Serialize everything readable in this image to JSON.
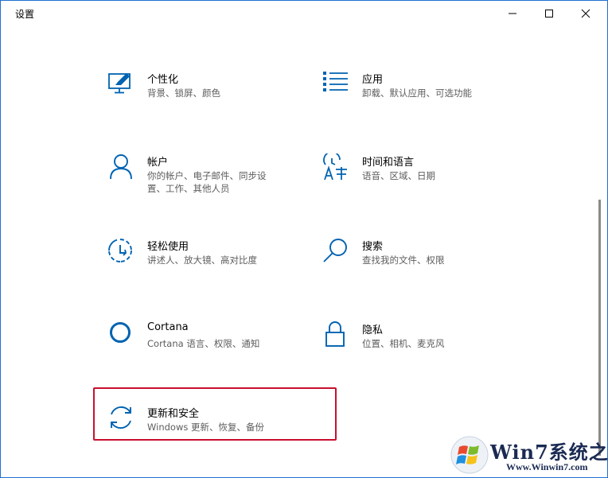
{
  "window": {
    "title": "设置"
  },
  "tiles": [
    {
      "label": "个性化",
      "desc": "背景、锁屏、颜色",
      "icon": "personalization-icon"
    },
    {
      "label": "应用",
      "desc": "卸载、默认应用、可选功能",
      "icon": "apps-icon"
    },
    {
      "label": "帐户",
      "desc": "你的帐户、电子邮件、同步设置、工作、其他人员",
      "icon": "accounts-icon"
    },
    {
      "label": "时间和语言",
      "desc": "语音、区域、日期",
      "icon": "time-language-icon"
    },
    {
      "label": "轻松使用",
      "desc": "讲述人、放大镜、高对比度",
      "icon": "ease-of-access-icon"
    },
    {
      "label": "搜索",
      "desc": "查找我的文件、权限",
      "icon": "search-icon"
    },
    {
      "label": "Cortana",
      "desc": "Cortana 语言、权限、通知",
      "icon": "cortana-icon"
    },
    {
      "label": "隐私",
      "desc": "位置、相机、麦克风",
      "icon": "lock-icon"
    },
    {
      "label": "更新和安全",
      "desc": "Windows 更新、恢复、备份",
      "icon": "update-icon"
    }
  ],
  "watermark": {
    "line1": "Win7系统之家",
    "line2": "Www.Winwin7.com"
  },
  "colors": {
    "accent": "#0063b1",
    "highlight": "#c8102e"
  }
}
